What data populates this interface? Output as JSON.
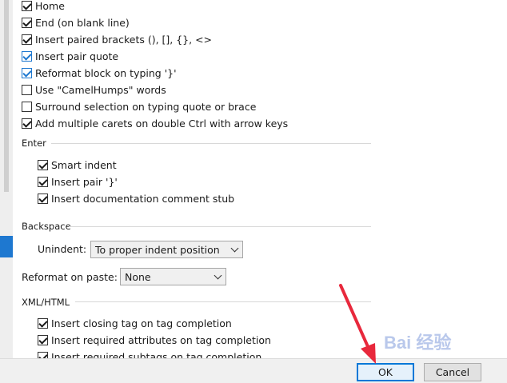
{
  "general_options": [
    {
      "label": "Home",
      "checked": true,
      "accent": false
    },
    {
      "label": "End (on blank line)",
      "checked": true,
      "accent": false
    },
    {
      "label": "Insert paired brackets (), [], {}, <>",
      "checked": true,
      "accent": false
    },
    {
      "label": "Insert pair quote",
      "checked": true,
      "accent": true
    },
    {
      "label": "Reformat block on typing '}'",
      "checked": true,
      "accent": true
    },
    {
      "label": "Use \"CamelHumps\" words",
      "checked": false,
      "accent": false
    },
    {
      "label": "Surround selection on typing quote or brace",
      "checked": false,
      "accent": false
    },
    {
      "label": "Add multiple carets on double Ctrl with arrow keys",
      "checked": true,
      "accent": false
    }
  ],
  "enter": {
    "title": "Enter",
    "options": [
      {
        "label": "Smart indent",
        "checked": true
      },
      {
        "label": "Insert pair '}'",
        "checked": true
      },
      {
        "label": "Insert documentation comment stub",
        "checked": true
      }
    ]
  },
  "backspace": {
    "title": "Backspace",
    "unindent_label": "Unindent:",
    "unindent_value": "To proper indent position"
  },
  "reformat": {
    "label": "Reformat on paste:",
    "value": "None"
  },
  "xml_html": {
    "title": "XML/HTML",
    "options": [
      {
        "label": "Insert closing tag on tag completion",
        "checked": true
      },
      {
        "label": "Insert required attributes on tag completion",
        "checked": true
      },
      {
        "label": "Insert required subtags on tag completion",
        "checked": true
      }
    ]
  },
  "buttons": {
    "ok": "OK",
    "cancel": "Cancel"
  },
  "watermark": "Bai 经验",
  "colors": {
    "accent": "#1e78d0",
    "arrow": "#e8283c",
    "footer": "#f0f0f0"
  }
}
